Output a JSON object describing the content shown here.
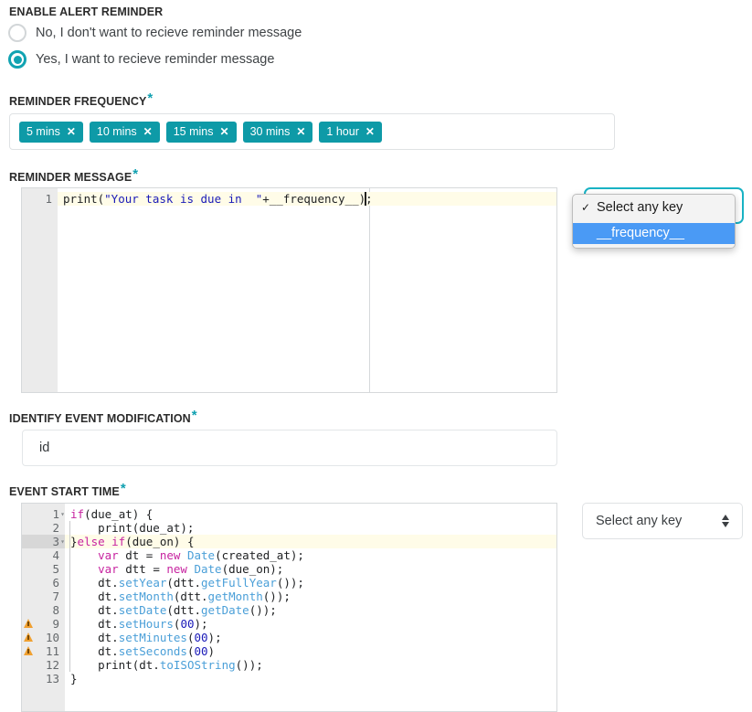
{
  "enable_alert": {
    "label": "ENABLE ALERT REMINDER",
    "options": [
      {
        "label": "No, I don't want to recieve reminder message",
        "checked": false
      },
      {
        "label": "Yes, I want to recieve reminder message",
        "checked": true
      }
    ]
  },
  "reminder_frequency": {
    "label": "REMINDER FREQUENCY",
    "required_marker": "*",
    "tags": [
      {
        "label": "5 mins",
        "remove": "✕"
      },
      {
        "label": "10 mins",
        "remove": "✕"
      },
      {
        "label": "15 mins",
        "remove": "✕"
      },
      {
        "label": "30 mins",
        "remove": "✕"
      },
      {
        "label": "1 hour",
        "remove": "✕"
      }
    ]
  },
  "reminder_message": {
    "label": "REMINDER MESSAGE",
    "required_marker": "*",
    "line_number": "1",
    "code": {
      "prefix": "print(",
      "string": "\"Your task is due in  \"",
      "suffix": "+__frequency__);"
    },
    "key_select": {
      "value": "Select any key",
      "focused": true
    },
    "dropdown": {
      "check_glyph": "✓",
      "items": [
        {
          "label": "Select any key",
          "checked": true,
          "highlighted": false
        },
        {
          "label": "__frequency__",
          "checked": false,
          "highlighted": true
        }
      ]
    }
  },
  "identify_event_modification": {
    "label": "IDENTIFY EVENT MODIFICATION",
    "required_marker": "*",
    "value": "id",
    "placeholder": ""
  },
  "event_start_time": {
    "label": "EVENT START TIME",
    "required_marker": "*",
    "key_select": {
      "value": "Select any key"
    },
    "editor": {
      "lines": [
        {
          "n": "1",
          "fold": "▾",
          "warn": false,
          "active": false,
          "indent": 0,
          "tokens": [
            {
              "t": "kw",
              "v": "if"
            },
            {
              "t": "",
              "v": "(due_at) {"
            }
          ]
        },
        {
          "n": "2",
          "fold": "",
          "warn": false,
          "active": false,
          "indent": 1,
          "tokens": [
            {
              "t": "",
              "v": "    print(due_at);"
            }
          ]
        },
        {
          "n": "3",
          "fold": "▾",
          "warn": false,
          "active": true,
          "indent": 1,
          "tokens": [
            {
              "t": "",
              "v": "}"
            },
            {
              "t": "kw",
              "v": "else if"
            },
            {
              "t": "",
              "v": "(due_on) {"
            }
          ]
        },
        {
          "n": "4",
          "fold": "",
          "warn": false,
          "active": false,
          "indent": 1,
          "tokens": [
            {
              "t": "",
              "v": "    "
            },
            {
              "t": "kw",
              "v": "var"
            },
            {
              "t": "",
              "v": " dt = "
            },
            {
              "t": "kw",
              "v": "new"
            },
            {
              "t": "",
              "v": " "
            },
            {
              "t": "type",
              "v": "Date"
            },
            {
              "t": "",
              "v": "(created_at);"
            }
          ]
        },
        {
          "n": "5",
          "fold": "",
          "warn": false,
          "active": false,
          "indent": 1,
          "tokens": [
            {
              "t": "",
              "v": "    "
            },
            {
              "t": "kw",
              "v": "var"
            },
            {
              "t": "",
              "v": " dtt = "
            },
            {
              "t": "kw",
              "v": "new"
            },
            {
              "t": "",
              "v": " "
            },
            {
              "t": "type",
              "v": "Date"
            },
            {
              "t": "",
              "v": "(due_on);"
            }
          ]
        },
        {
          "n": "6",
          "fold": "",
          "warn": false,
          "active": false,
          "indent": 1,
          "tokens": [
            {
              "t": "",
              "v": "    dt."
            },
            {
              "t": "fn",
              "v": "setYear"
            },
            {
              "t": "",
              "v": "(dtt."
            },
            {
              "t": "fn",
              "v": "getFullYear"
            },
            {
              "t": "",
              "v": "());"
            }
          ]
        },
        {
          "n": "7",
          "fold": "",
          "warn": false,
          "active": false,
          "indent": 1,
          "tokens": [
            {
              "t": "",
              "v": "    dt."
            },
            {
              "t": "fn",
              "v": "setMonth"
            },
            {
              "t": "",
              "v": "(dtt."
            },
            {
              "t": "fn",
              "v": "getMonth"
            },
            {
              "t": "",
              "v": "());"
            }
          ]
        },
        {
          "n": "8",
          "fold": "",
          "warn": false,
          "active": false,
          "indent": 1,
          "tokens": [
            {
              "t": "",
              "v": "    dt."
            },
            {
              "t": "fn",
              "v": "setDate"
            },
            {
              "t": "",
              "v": "(dtt."
            },
            {
              "t": "fn",
              "v": "getDate"
            },
            {
              "t": "",
              "v": "());"
            }
          ]
        },
        {
          "n": "9",
          "fold": "",
          "warn": true,
          "active": false,
          "indent": 1,
          "tokens": [
            {
              "t": "",
              "v": "    dt."
            },
            {
              "t": "fn",
              "v": "setHours"
            },
            {
              "t": "",
              "v": "("
            },
            {
              "t": "num",
              "v": "00"
            },
            {
              "t": "",
              "v": ");"
            }
          ]
        },
        {
          "n": "10",
          "fold": "",
          "warn": true,
          "active": false,
          "indent": 1,
          "tokens": [
            {
              "t": "",
              "v": "    dt."
            },
            {
              "t": "fn",
              "v": "setMinutes"
            },
            {
              "t": "",
              "v": "("
            },
            {
              "t": "num",
              "v": "00"
            },
            {
              "t": "",
              "v": ");"
            }
          ]
        },
        {
          "n": "11",
          "fold": "",
          "warn": true,
          "active": false,
          "indent": 1,
          "tokens": [
            {
              "t": "",
              "v": "    dt."
            },
            {
              "t": "fn",
              "v": "setSeconds"
            },
            {
              "t": "",
              "v": "("
            },
            {
              "t": "num",
              "v": "00"
            },
            {
              "t": "",
              "v": ")"
            }
          ]
        },
        {
          "n": "12",
          "fold": "",
          "warn": false,
          "active": false,
          "indent": 1,
          "tokens": [
            {
              "t": "",
              "v": "    print(dt."
            },
            {
              "t": "fn",
              "v": "toISOString"
            },
            {
              "t": "",
              "v": "());"
            }
          ]
        },
        {
          "n": "13",
          "fold": "",
          "warn": false,
          "active": false,
          "indent": 0,
          "tokens": [
            {
              "t": "",
              "v": "}"
            }
          ]
        }
      ]
    }
  },
  "colors": {
    "accent_teal": "#0e9aa7",
    "focus_teal": "#19b2c4",
    "highlight_blue": "#4a9af5",
    "warn_amber": "#f0a030",
    "active_line": "#fffce8"
  }
}
